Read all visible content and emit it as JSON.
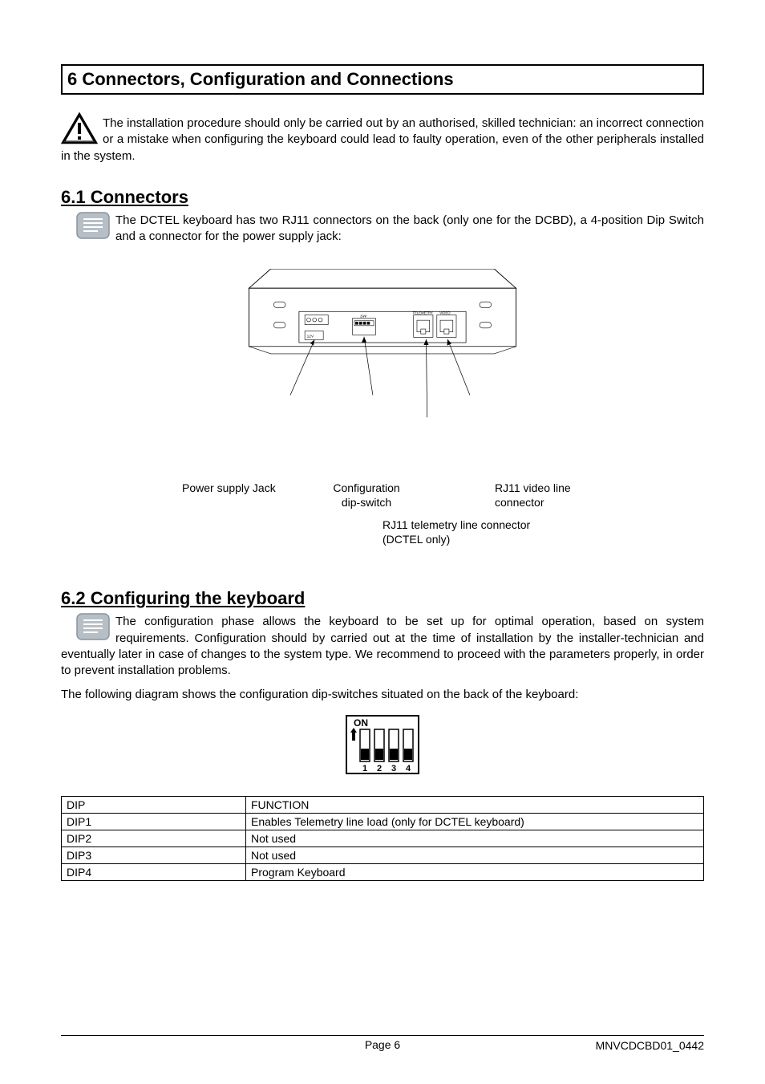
{
  "section_title": "6 Connectors, Configuration and Connections",
  "warning_text": "The installation procedure should only be carried out by an authorised, skilled technician: an incorrect connection or a mistake when configuring the keyboard could lead to faulty operation, even of the other peripherals installed in the system.",
  "sub1_title": "6.1 Connectors",
  "note1_text": "The DCTEL keyboard has two RJ11 connectors on the back (only one for the DCBD), a 4-position Dip Switch and a connector for the power supply jack:",
  "figure": {
    "psj": "Power supply Jack",
    "cfg1": "Configuration",
    "cfg2": "dip-switch",
    "rj11v1": "RJ11 video line",
    "rj11v2": "connector",
    "rj11t1": "RJ11 telemetry line connector",
    "rj11t2": "(DCTEL only)",
    "panel_sw": "SW",
    "panel_tel": "TELEMETRY",
    "panel_vid": "VIDEO",
    "panel_12v": "12V"
  },
  "sub2_title": "6.2 Configuring the keyboard",
  "note2_text": "The configuration phase allows the keyboard to be set up for optimal operation, based on system requirements. Configuration should by carried out at the time of installation by the installer-technician and eventually later in case of changes to the system type. We recommend to proceed with the parameters properly, in order to prevent installation problems.",
  "diagram_intro": "The following diagram shows the configuration dip-switches situated on the back of the keyboard:",
  "dip_on": "ON",
  "dip_nums": [
    "1",
    "2",
    "3",
    "4"
  ],
  "table": {
    "head_dip": "DIP",
    "head_func": "FUNCTION",
    "rows": [
      {
        "dip": "DIP1",
        "func": "Enables Telemetry line load (only for DCTEL keyboard)"
      },
      {
        "dip": "DIP2",
        "func": "Not used"
      },
      {
        "dip": "DIP3",
        "func": "Not used"
      },
      {
        "dip": "DIP4",
        "func": "Program Keyboard"
      }
    ]
  },
  "footer_page": "Page 6",
  "footer_doc": "MNVCDCBD01_0442"
}
